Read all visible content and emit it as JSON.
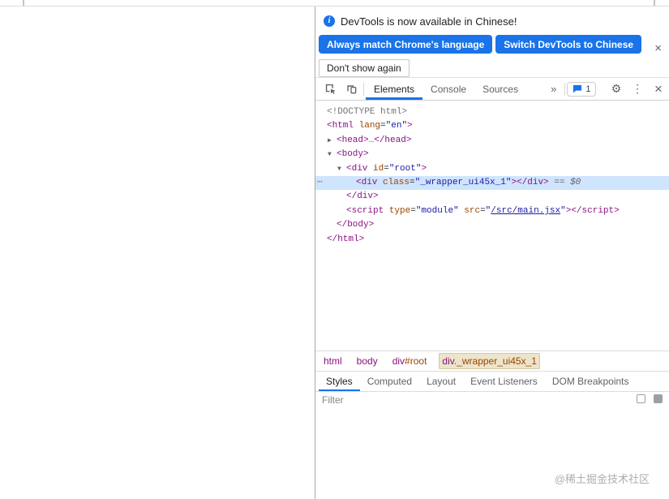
{
  "notification": {
    "message": "DevTools is now available in Chinese!",
    "primary_button": "Always match Chrome's language",
    "secondary_button": "Switch DevTools to Chinese",
    "tertiary_button": "Don't show again",
    "close_icon": "×",
    "info_icon": "i"
  },
  "toolbar": {
    "tabs": [
      {
        "label": "Elements",
        "active": true
      },
      {
        "label": "Console",
        "active": false
      },
      {
        "label": "Sources",
        "active": false
      }
    ],
    "more_tabs_icon": "»",
    "issues": {
      "count": "1"
    },
    "gear_icon": "⚙",
    "menu_icon": "⋮",
    "close_icon": "×"
  },
  "dom_tree": {
    "lines": [
      {
        "indent": 0,
        "tokens": [
          [
            "doctype",
            "<!DOCTYPE html>"
          ]
        ]
      },
      {
        "indent": 0,
        "tokens": [
          [
            "tag",
            "<html"
          ],
          [
            "attr",
            " lang"
          ],
          [
            "eq",
            "="
          ],
          [
            "val",
            "\"en\""
          ],
          [
            "tag",
            ">"
          ]
        ]
      },
      {
        "indent": 1,
        "arrow": "▶",
        "tokens": [
          [
            "tag",
            "<head>"
          ],
          [
            "dots",
            "…"
          ],
          [
            "tag",
            "</head>"
          ]
        ]
      },
      {
        "indent": 1,
        "arrow": "▼",
        "tokens": [
          [
            "tag",
            "<body>"
          ]
        ]
      },
      {
        "indent": 2,
        "arrow": "▼",
        "tokens": [
          [
            "tag",
            "<div"
          ],
          [
            "attr",
            " id"
          ],
          [
            "eq",
            "="
          ],
          [
            "val",
            "\"root\""
          ],
          [
            "tag",
            ">"
          ]
        ]
      },
      {
        "indent": 3,
        "selected": true,
        "gutter": "⋯",
        "tokens": [
          [
            "tag",
            "<div"
          ],
          [
            "attr",
            " class"
          ],
          [
            "eq",
            "="
          ],
          [
            "val",
            "\"_wrapper_ui45x_1\""
          ],
          [
            "tag",
            "></div>"
          ],
          [
            "marker",
            " == $0"
          ]
        ]
      },
      {
        "indent": 2,
        "tokens": [
          [
            "tag",
            "</div>"
          ]
        ]
      },
      {
        "indent": 2,
        "tokens": [
          [
            "tag",
            "<script"
          ],
          [
            "attr",
            " type"
          ],
          [
            "eq",
            "="
          ],
          [
            "val",
            "\"module\""
          ],
          [
            "attr",
            " src"
          ],
          [
            "eq",
            "="
          ],
          [
            "val",
            "\""
          ],
          [
            "link",
            "/src/main.jsx"
          ],
          [
            "val",
            "\""
          ],
          [
            "tag",
            "></script>"
          ]
        ]
      },
      {
        "indent": 1,
        "tokens": [
          [
            "tag",
            "</body>"
          ]
        ]
      },
      {
        "indent": 0,
        "tokens": [
          [
            "tag",
            "</html>"
          ]
        ]
      }
    ]
  },
  "breadcrumbs": {
    "items": [
      {
        "parts": [
          [
            "tag",
            "html"
          ]
        ],
        "selected": false
      },
      {
        "parts": [
          [
            "tag",
            "body"
          ]
        ],
        "selected": false
      },
      {
        "parts": [
          [
            "tag",
            "div"
          ],
          [
            "id",
            "#root"
          ]
        ],
        "selected": false
      },
      {
        "parts": [
          [
            "tag",
            "div"
          ],
          [
            "cls",
            "._wrapper_ui45x_1"
          ]
        ],
        "selected": true
      }
    ]
  },
  "sidebar": {
    "tabs": [
      {
        "label": "Styles",
        "active": true
      },
      {
        "label": "Computed",
        "active": false
      },
      {
        "label": "Layout",
        "active": false
      },
      {
        "label": "Event Listeners",
        "active": false
      },
      {
        "label": "DOM Breakpoints",
        "active": false
      }
    ],
    "filter_text": "Filter"
  },
  "watermark": "@稀土掘金技术社区",
  "colors": {
    "accent": "#1a73e8",
    "tag": "#881280",
    "attr": "#994500",
    "value": "#1a1aa6",
    "selected_row": "#cfe4fd"
  }
}
